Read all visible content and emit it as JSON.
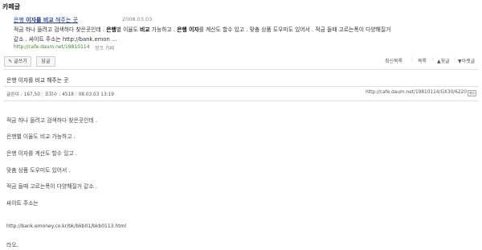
{
  "section": {
    "title": "카페글"
  },
  "result": {
    "title_a": "은행 ",
    "title_b": "이자를 비교",
    "title_c": " 해주는 곳",
    "date": "2008.03.03",
    "snippet1_a": "적금 하나 들려고 검색하다 찾은곳인데 . ",
    "snippet1_b": "은행",
    "snippet1_c": "별 이율도 ",
    "snippet1_d": "비교",
    "snippet1_e": " 가능하고 . ",
    "snippet1_f": "은행 이자",
    "snippet1_g": "를 계산도 할수 있고 . 맞춤 상품 도우미도 있어서 . 적금 들때 고르는폭이 다양해질거",
    "snippet2": "같소 . 싸이트 주소는 http://bank.emon ...",
    "url": "http://cafe.daum.net/19810114",
    "cafe": "쌍코 카페"
  },
  "toolbar": {
    "write_label": "글쓰기",
    "reply_label": "답글",
    "latest_label": "최신목록",
    "list_label": "목록",
    "prev_label": "▲윗글",
    "next_label": "▼아랫글"
  },
  "post": {
    "title": "은행 이자를 비교 해주는 곳",
    "author_label": "글쓴이 : 167,50",
    "views_label": "조회수 : 4518",
    "datetime": "08.03.03 13:19",
    "link": "http://cafe.daum.net/19810114/GX30/6220",
    "copy_icon": "복사",
    "lines": [
      "적금 하나 들려고 검색하다 찾은곳인데 .",
      "은행별 이율도 비교 가능하고 .",
      "은행 이자를 계산도 할수 있고 .",
      "맞춤 상품 도우미도 있어서 .",
      "적금 들때 고르는폭이 다양해질거 같소 .",
      "싸이트 주소는",
      "http://bank.emoney.co.kr/bk/bkb01/bkb0113.html",
      "라오."
    ]
  }
}
